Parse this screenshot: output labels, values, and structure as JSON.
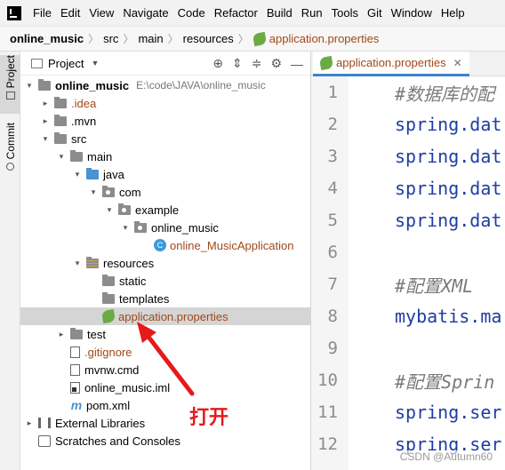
{
  "menubar": {
    "items": [
      "File",
      "Edit",
      "View",
      "Navigate",
      "Code",
      "Refactor",
      "Build",
      "Run",
      "Tools",
      "Git",
      "Window",
      "Help"
    ]
  },
  "breadcrumb": {
    "items": [
      "online_music",
      "src",
      "main",
      "resources",
      "application.properties"
    ]
  },
  "sidebar": {
    "tabs": [
      "Project",
      "Commit"
    ]
  },
  "project_panel": {
    "title": "Project",
    "tree": [
      {
        "label": "online_music",
        "path": "E:\\code\\JAVA\\online_music"
      },
      {
        "label": ".idea"
      },
      {
        "label": ".mvn"
      },
      {
        "label": "src"
      },
      {
        "label": "main"
      },
      {
        "label": "java"
      },
      {
        "label": "com"
      },
      {
        "label": "example"
      },
      {
        "label": "online_music"
      },
      {
        "label": "online_MusicApplication"
      },
      {
        "label": "resources"
      },
      {
        "label": "static"
      },
      {
        "label": "templates"
      },
      {
        "label": "application.properties"
      },
      {
        "label": "test"
      },
      {
        "label": ".gitignore"
      },
      {
        "label": "mvnw.cmd"
      },
      {
        "label": "online_music.iml"
      },
      {
        "label": "pom.xml"
      },
      {
        "label": "External Libraries"
      },
      {
        "label": "Scratches and Consoles"
      }
    ]
  },
  "annotation": {
    "text": "打开",
    "color": "#e61a1a"
  },
  "editor": {
    "tab_label": "application.properties",
    "lines": [
      {
        "num": "1",
        "text": "#数据库的配"
      },
      {
        "num": "2",
        "text": "spring.dat"
      },
      {
        "num": "3",
        "text": "spring.dat"
      },
      {
        "num": "4",
        "text": "spring.dat"
      },
      {
        "num": "5",
        "text": "spring.dat"
      },
      {
        "num": "6",
        "text": ""
      },
      {
        "num": "7",
        "text": "#配置XML"
      },
      {
        "num": "8",
        "text": "mybatis.ma"
      },
      {
        "num": "9",
        "text": ""
      },
      {
        "num": "10",
        "text": "#配置Sprin"
      },
      {
        "num": "11",
        "text": "spring.ser"
      },
      {
        "num": "12",
        "text": "spring.ser"
      }
    ]
  },
  "watermark": "CSDN @Autumn60",
  "colors": {
    "accent": "#4083c9",
    "file_orange": "#a0481a",
    "selection": "#d5d5d5"
  }
}
